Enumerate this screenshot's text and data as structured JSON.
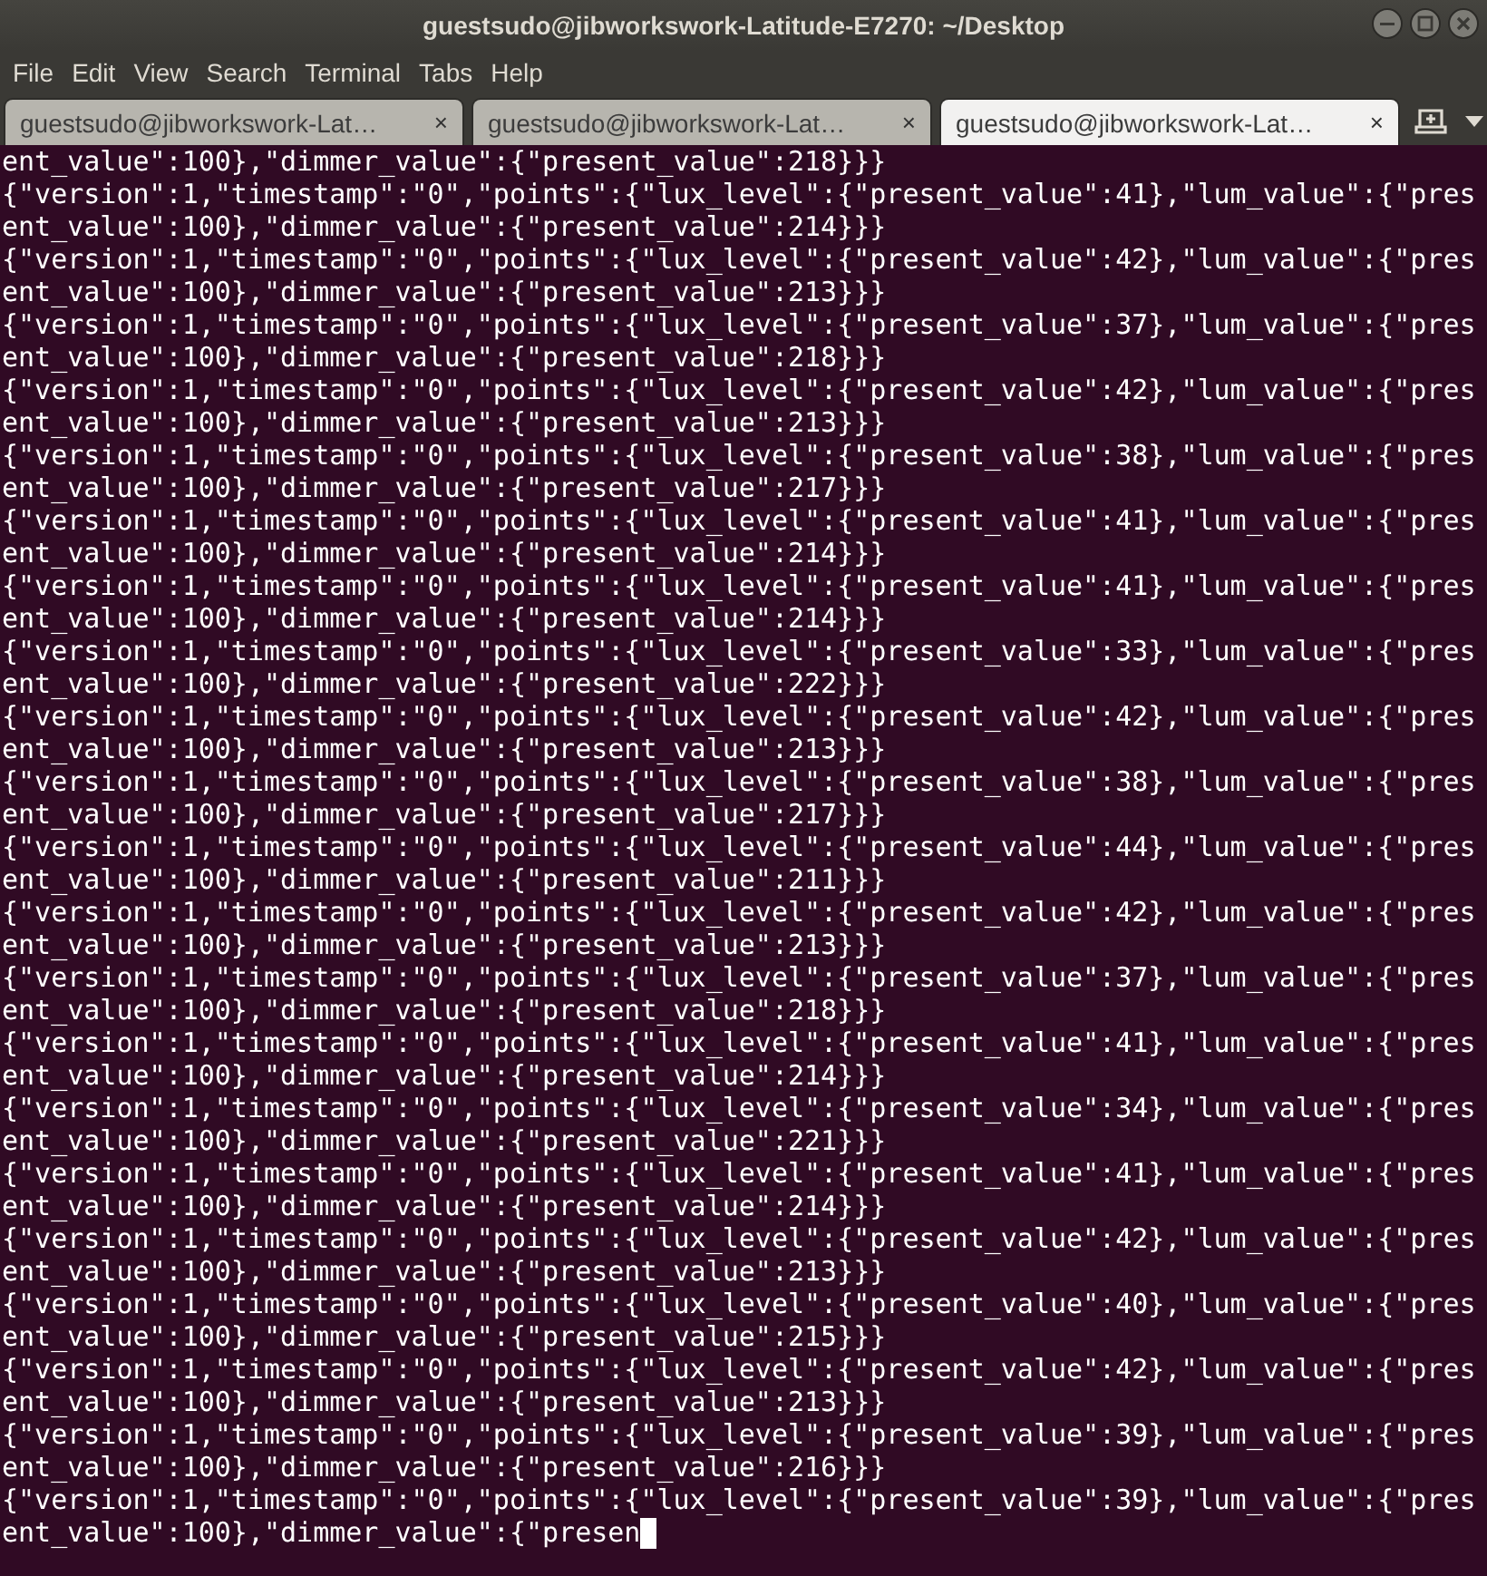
{
  "window": {
    "title": "guestsudo@jibworkswork-Latitude-E7270: ~/Desktop"
  },
  "menu": [
    "File",
    "Edit",
    "View",
    "Search",
    "Terminal",
    "Tabs",
    "Help"
  ],
  "tabs": [
    {
      "label": "guestsudo@jibworkswork-Lat…",
      "close": "×",
      "selected": false
    },
    {
      "label": "guestsudo@jibworkswork-Lat…",
      "close": "×",
      "selected": false
    },
    {
      "label": "guestsudo@jibworkswork-Lat…",
      "close": "×",
      "selected": true
    }
  ],
  "terminal": {
    "cursor": true,
    "lines": [
      "ent_value\":100},\"dimmer_value\":{\"present_value\":218}}}",
      "{\"version\":1,\"timestamp\":\"0\",\"points\":{\"lux_level\":{\"present_value\":41},\"lum_value\":{\"pres",
      "ent_value\":100},\"dimmer_value\":{\"present_value\":214}}}",
      "{\"version\":1,\"timestamp\":\"0\",\"points\":{\"lux_level\":{\"present_value\":42},\"lum_value\":{\"pres",
      "ent_value\":100},\"dimmer_value\":{\"present_value\":213}}}",
      "{\"version\":1,\"timestamp\":\"0\",\"points\":{\"lux_level\":{\"present_value\":37},\"lum_value\":{\"pres",
      "ent_value\":100},\"dimmer_value\":{\"present_value\":218}}}",
      "{\"version\":1,\"timestamp\":\"0\",\"points\":{\"lux_level\":{\"present_value\":42},\"lum_value\":{\"pres",
      "ent_value\":100},\"dimmer_value\":{\"present_value\":213}}}",
      "{\"version\":1,\"timestamp\":\"0\",\"points\":{\"lux_level\":{\"present_value\":38},\"lum_value\":{\"pres",
      "ent_value\":100},\"dimmer_value\":{\"present_value\":217}}}",
      "{\"version\":1,\"timestamp\":\"0\",\"points\":{\"lux_level\":{\"present_value\":41},\"lum_value\":{\"pres",
      "ent_value\":100},\"dimmer_value\":{\"present_value\":214}}}",
      "{\"version\":1,\"timestamp\":\"0\",\"points\":{\"lux_level\":{\"present_value\":41},\"lum_value\":{\"pres",
      "ent_value\":100},\"dimmer_value\":{\"present_value\":214}}}",
      "{\"version\":1,\"timestamp\":\"0\",\"points\":{\"lux_level\":{\"present_value\":33},\"lum_value\":{\"pres",
      "ent_value\":100},\"dimmer_value\":{\"present_value\":222}}}",
      "{\"version\":1,\"timestamp\":\"0\",\"points\":{\"lux_level\":{\"present_value\":42},\"lum_value\":{\"pres",
      "ent_value\":100},\"dimmer_value\":{\"present_value\":213}}}",
      "{\"version\":1,\"timestamp\":\"0\",\"points\":{\"lux_level\":{\"present_value\":38},\"lum_value\":{\"pres",
      "ent_value\":100},\"dimmer_value\":{\"present_value\":217}}}",
      "{\"version\":1,\"timestamp\":\"0\",\"points\":{\"lux_level\":{\"present_value\":44},\"lum_value\":{\"pres",
      "ent_value\":100},\"dimmer_value\":{\"present_value\":211}}}",
      "{\"version\":1,\"timestamp\":\"0\",\"points\":{\"lux_level\":{\"present_value\":42},\"lum_value\":{\"pres",
      "ent_value\":100},\"dimmer_value\":{\"present_value\":213}}}",
      "{\"version\":1,\"timestamp\":\"0\",\"points\":{\"lux_level\":{\"present_value\":37},\"lum_value\":{\"pres",
      "ent_value\":100},\"dimmer_value\":{\"present_value\":218}}}",
      "{\"version\":1,\"timestamp\":\"0\",\"points\":{\"lux_level\":{\"present_value\":41},\"lum_value\":{\"pres",
      "ent_value\":100},\"dimmer_value\":{\"present_value\":214}}}",
      "{\"version\":1,\"timestamp\":\"0\",\"points\":{\"lux_level\":{\"present_value\":34},\"lum_value\":{\"pres",
      "ent_value\":100},\"dimmer_value\":{\"present_value\":221}}}",
      "{\"version\":1,\"timestamp\":\"0\",\"points\":{\"lux_level\":{\"present_value\":41},\"lum_value\":{\"pres",
      "ent_value\":100},\"dimmer_value\":{\"present_value\":214}}}",
      "{\"version\":1,\"timestamp\":\"0\",\"points\":{\"lux_level\":{\"present_value\":42},\"lum_value\":{\"pres",
      "ent_value\":100},\"dimmer_value\":{\"present_value\":213}}}",
      "{\"version\":1,\"timestamp\":\"0\",\"points\":{\"lux_level\":{\"present_value\":40},\"lum_value\":{\"pres",
      "ent_value\":100},\"dimmer_value\":{\"present_value\":215}}}",
      "{\"version\":1,\"timestamp\":\"0\",\"points\":{\"lux_level\":{\"present_value\":42},\"lum_value\":{\"pres",
      "ent_value\":100},\"dimmer_value\":{\"present_value\":213}}}",
      "{\"version\":1,\"timestamp\":\"0\",\"points\":{\"lux_level\":{\"present_value\":39},\"lum_value\":{\"pres",
      "ent_value\":100},\"dimmer_value\":{\"present_value\":216}}}",
      "{\"version\":1,\"timestamp\":\"0\",\"points\":{\"lux_level\":{\"present_value\":39},\"lum_value\":{\"pres",
      "ent_value\":100},\"dimmer_value\":{\"presen"
    ]
  }
}
